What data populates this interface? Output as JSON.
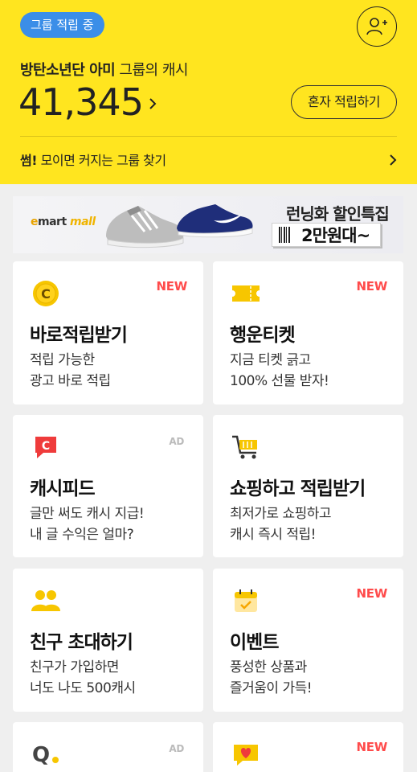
{
  "header": {
    "badge": "그룹 적립 중",
    "group_name": "방탄소년단 아미",
    "group_suffix": "그룹의 캐시",
    "cash": "41,345",
    "solo_button": "혼자 적립하기",
    "find_prefix": "썸!",
    "find_text": "모이면 커지는 그룹 찾기"
  },
  "banner": {
    "brand_e": "e",
    "brand_mart": "mart",
    "brand_mall": "mall",
    "title": "런닝화 할인특집",
    "subtitle": "2만원대~"
  },
  "cards": [
    {
      "icon": "coin-c-icon",
      "tag": "NEW",
      "title": "바로적립받기",
      "desc1": "적립 가능한",
      "desc2": "광고 바로 적립"
    },
    {
      "icon": "ticket-icon",
      "tag": "NEW",
      "title": "행운티켓",
      "desc1": "지금 티켓 긁고",
      "desc2": "100% 선물 받자!"
    },
    {
      "icon": "cashfeed-icon",
      "tag": "AD",
      "title": "캐시피드",
      "desc1": "글만 써도 캐시 지급!",
      "desc2": "내 글 수익은 얼마?"
    },
    {
      "icon": "cart-icon",
      "tag": "",
      "title": "쇼핑하고 적립받기",
      "desc1": "최저가로 쇼핑하고",
      "desc2": "캐시 즉시 적립!"
    },
    {
      "icon": "friends-icon",
      "tag": "",
      "title": "친구 초대하기",
      "desc1": "친구가 가입하면",
      "desc2": "너도 나도 500캐시"
    },
    {
      "icon": "calendar-check-icon",
      "tag": "NEW",
      "title": "이벤트",
      "desc1": "풍성한 상품과",
      "desc2": "즐거움이 가득!"
    },
    {
      "icon": "q-logo-icon",
      "tag": "AD",
      "title": "",
      "desc1": "",
      "desc2": ""
    },
    {
      "icon": "heart-message-icon",
      "tag": "NEW",
      "title": "",
      "desc1": "",
      "desc2": ""
    }
  ],
  "colors": {
    "header_bg": "#ffe51f",
    "badge_bg": "#3b8ee8",
    "new_tag": "#ff4b4b",
    "accent_yellow": "#f7c600"
  }
}
